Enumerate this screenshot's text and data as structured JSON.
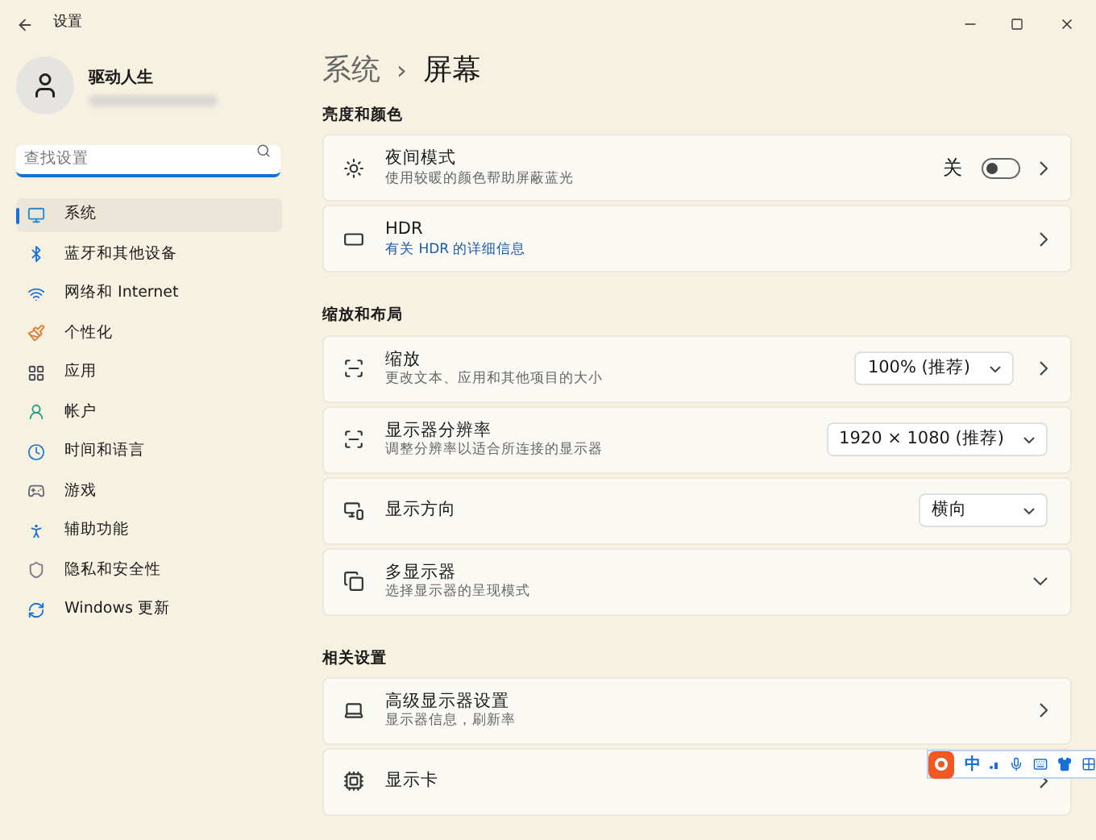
{
  "window": {
    "title": "设置"
  },
  "user": {
    "name": "驱动人生"
  },
  "search": {
    "placeholder": "查找设置"
  },
  "sidebar": {
    "items": [
      {
        "label": "系统",
        "selected": true
      },
      {
        "label": "蓝牙和其他设备",
        "selected": false
      },
      {
        "label": "网络和 Internet",
        "selected": false
      },
      {
        "label": "个性化",
        "selected": false
      },
      {
        "label": "应用",
        "selected": false
      },
      {
        "label": "帐户",
        "selected": false
      },
      {
        "label": "时间和语言",
        "selected": false
      },
      {
        "label": "游戏",
        "selected": false
      },
      {
        "label": "辅助功能",
        "selected": false
      },
      {
        "label": "隐私和安全性",
        "selected": false
      },
      {
        "label": "Windows 更新",
        "selected": false
      }
    ]
  },
  "breadcrumb": {
    "parent": "系统",
    "separator": "›",
    "current": "屏幕"
  },
  "sections": [
    {
      "heading": "亮度和颜色",
      "rows": [
        {
          "kind": "toggle",
          "title": "夜间模式",
          "subtitle": "使用较暖的颜色帮助屏蔽蓝光",
          "state_label": "关",
          "on": false
        },
        {
          "kind": "link",
          "title": "HDR",
          "link": "有关 HDR 的详细信息"
        }
      ]
    },
    {
      "heading": "缩放和布局",
      "rows": [
        {
          "kind": "dropdown-nav",
          "title": "缩放",
          "subtitle": "更改文本、应用和其他项目的大小",
          "value": "100% (推荐)"
        },
        {
          "kind": "dropdown",
          "title": "显示器分辨率",
          "subtitle": "调整分辨率以适合所连接的显示器",
          "value": "1920 × 1080 (推荐)"
        },
        {
          "kind": "dropdown",
          "title": "显示方向",
          "value": "横向"
        },
        {
          "kind": "expand",
          "title": "多显示器",
          "subtitle": "选择显示器的呈现模式",
          "expanded": false
        }
      ]
    },
    {
      "heading": "相关设置",
      "rows": [
        {
          "kind": "nav",
          "title": "高级显示器设置",
          "subtitle": "显示器信息，刷新率"
        },
        {
          "kind": "nav",
          "title": "显示卡"
        }
      ]
    }
  ],
  "ime_toolbar": {
    "mode": "中"
  }
}
